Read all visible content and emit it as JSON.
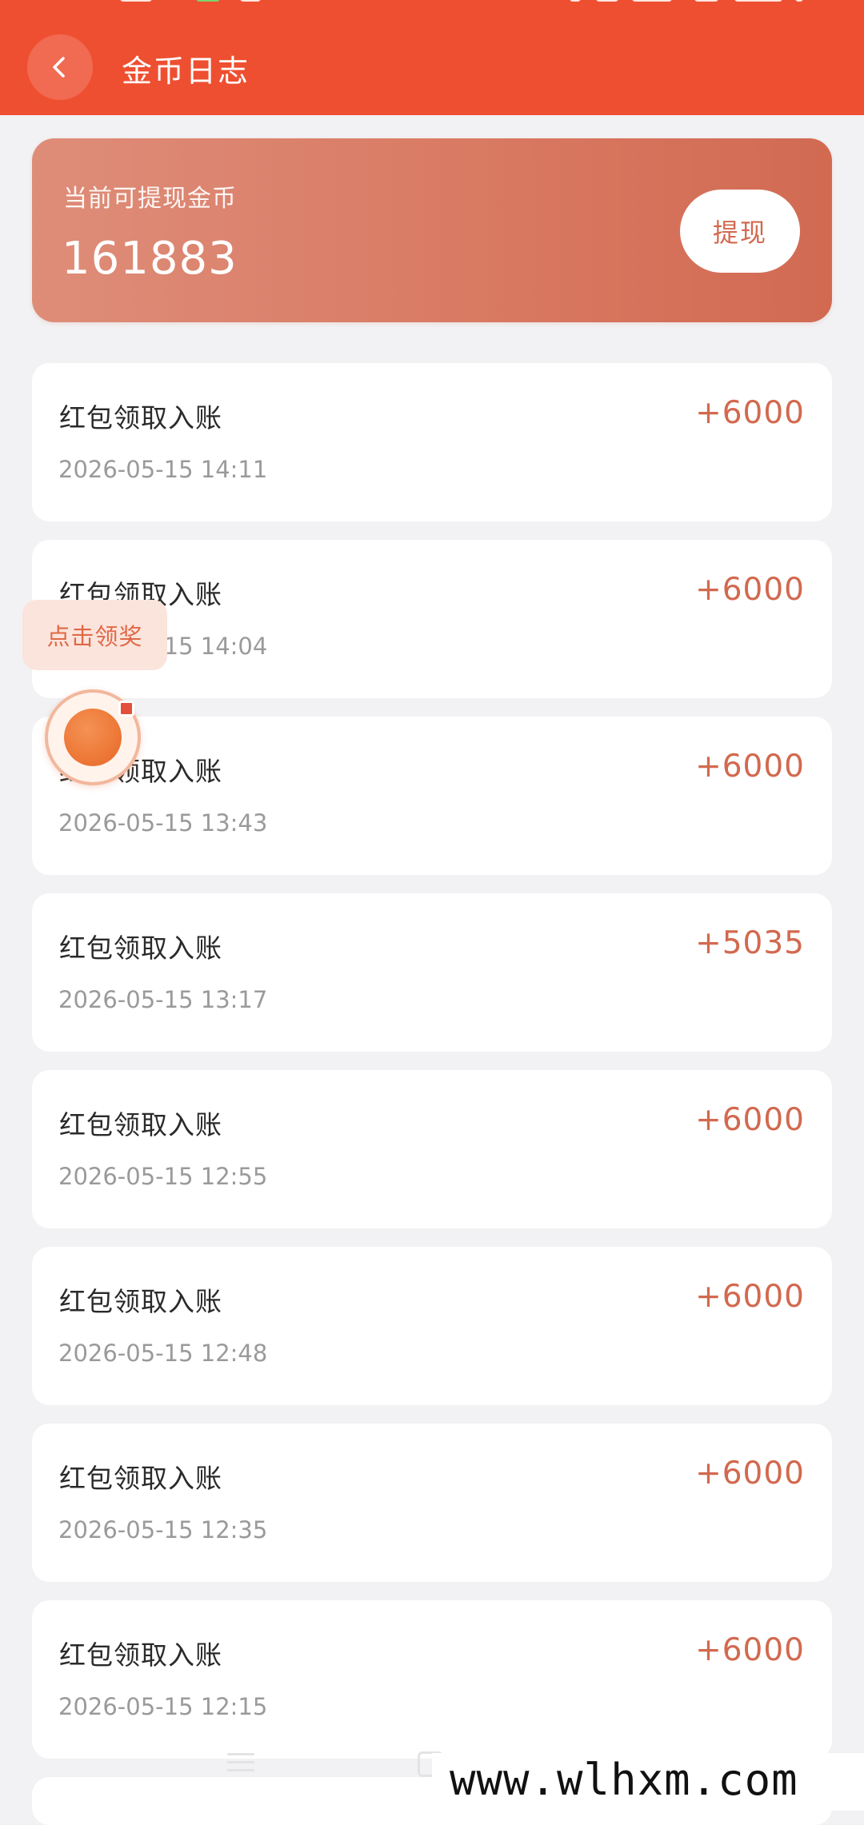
{
  "header": {
    "title": "金币日志",
    "background_color": "#ee4f30",
    "back_icon": "chevron-left-icon"
  },
  "balance_card": {
    "label": "当前可提现金币",
    "value": "161883",
    "withdraw_label": "提现"
  },
  "records": [
    {
      "title": "红包领取入账",
      "time": "2026-05-15 14:11",
      "amount": "+6000"
    },
    {
      "title": "红包领取入账",
      "time": "2026-05-15 14:04",
      "amount": "+6000"
    },
    {
      "title": "红包领取入账",
      "time": "2026-05-15 13:43",
      "amount": "+6000"
    },
    {
      "title": "红包领取入账",
      "time": "2026-05-15 13:17",
      "amount": "+5035"
    },
    {
      "title": "红包领取入账",
      "time": "2026-05-15 12:55",
      "amount": "+6000"
    },
    {
      "title": "红包领取入账",
      "time": "2026-05-15 12:48",
      "amount": "+6000"
    },
    {
      "title": "红包领取入账",
      "time": "2026-05-15 12:35",
      "amount": "+6000"
    },
    {
      "title": "红包领取入账",
      "time": "2026-05-15 12:15",
      "amount": "+6000"
    }
  ],
  "floating": {
    "reward_label": "点击领奖",
    "ball_icon": "reward-ball-icon"
  },
  "watermark": {
    "text": "www.wlhxm.com"
  },
  "colors": {
    "accent": "#d2694f",
    "page_background": "#f2f2f4"
  }
}
